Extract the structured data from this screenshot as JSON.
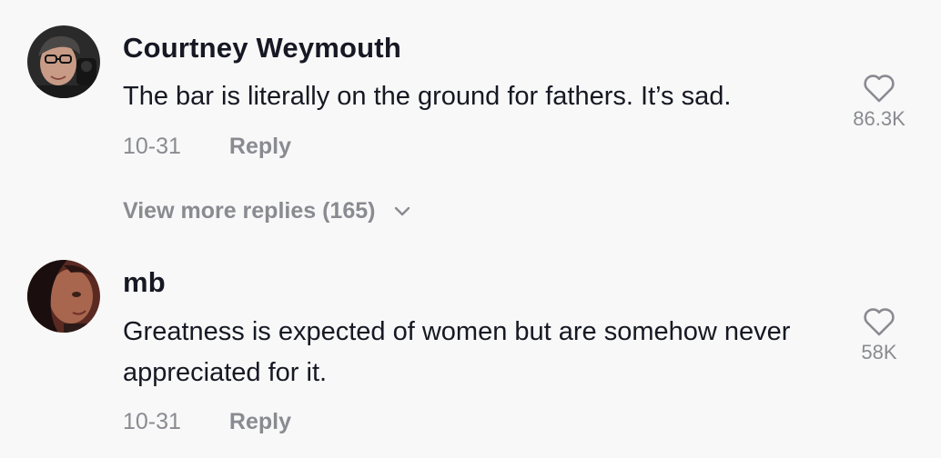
{
  "comments": [
    {
      "username": "Courtney Weymouth",
      "text": "The bar is literally on the ground for fathers. It’s sad.",
      "date": "10-31",
      "reply_label": "Reply",
      "like_count": "86.3K",
      "like_icon": "heart-outline-icon"
    },
    {
      "username": "mb",
      "text": "Greatness is expected of women but are somehow never appreciated for it.",
      "date": "10-31",
      "reply_label": "Reply",
      "like_count": "58K",
      "like_icon": "heart-outline-icon"
    }
  ],
  "view_more": {
    "label": "View more replies (165)",
    "icon": "chevron-down-icon"
  },
  "colors": {
    "background": "#f8f8f8",
    "primary_text": "#161823",
    "secondary_text": "#8a8b91"
  }
}
